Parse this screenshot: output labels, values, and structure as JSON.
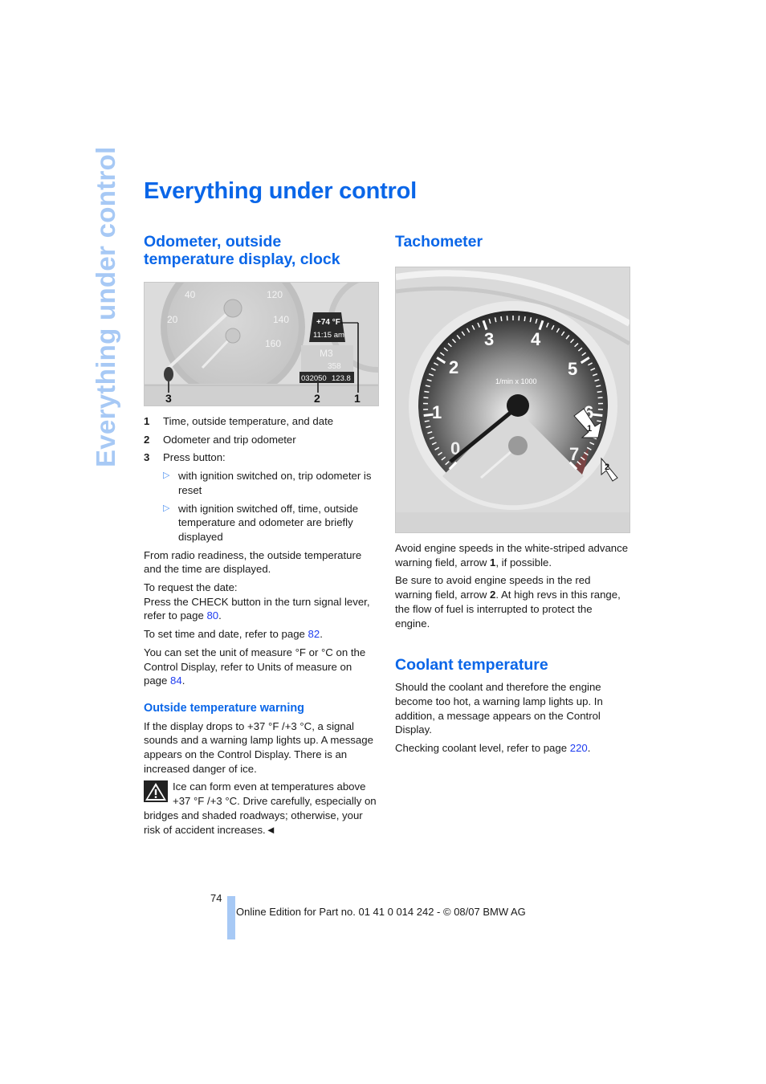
{
  "side_tab": "Everything under control",
  "page_title": "Everything under control",
  "left": {
    "heading": "Odometer, outside temperature display, clock",
    "figure": {
      "speedo_ticks": [
        "20",
        "40",
        "120",
        "140",
        "160"
      ],
      "temperature": "+74 °F",
      "time": "11:15 am",
      "model": "M3",
      "range": "358",
      "odometer": "032050",
      "trip": "123.8",
      "callouts": [
        "3",
        "2",
        "1"
      ]
    },
    "items": [
      {
        "num": "1",
        "text": "Time, outside temperature, and date"
      },
      {
        "num": "2",
        "text": "Odometer and trip odometer"
      },
      {
        "num": "3",
        "text": "Press button:"
      }
    ],
    "bullets": [
      "with ignition switched on, trip odometer is reset",
      "with ignition switched off, time, outside temperature and odometer are briefly displayed"
    ],
    "para_radio": "From radio readiness, the outside temperature and the time are displayed.",
    "para_date_1": "To request the date:",
    "para_date_2": "Press the CHECK button in the turn signal lever, refer to page ",
    "para_date_ref": "80",
    "para_set": "To set time and date, refer to page ",
    "para_set_ref": "82",
    "para_unit": "You can set the unit of measure °F or °C on the Control Display, refer to Units of measure on page ",
    "para_unit_ref": "84",
    "subheading": "Outside temperature warning",
    "para_warn": "If the display drops to +37 °F /+3 °C, a signal sounds and a warning lamp lights up. A message appears on the Control Display. There is an increased danger of ice.",
    "caution": "Ice can form even at temperatures above +37 °F /+3 °C. Drive carefully, especially on bridges and shaded roadways; otherwise, your risk of accident increases.◄"
  },
  "right": {
    "heading": "Tachometer",
    "figure": {
      "scale": [
        "0",
        "1",
        "2",
        "3",
        "4",
        "5",
        "6",
        "7"
      ],
      "unit_label": "1/min x 1000",
      "callouts": [
        "1",
        "2"
      ]
    },
    "para_1a": "Avoid engine speeds in the white-striped advance warning field, arrow ",
    "para_1b": "1",
    "para_1c": ", if possible.",
    "para_2a": "Be sure to avoid engine speeds in the red warning field, arrow ",
    "para_2b": "2",
    "para_2c": ". At high revs in this range, the flow of fuel is interrupted to protect the engine.",
    "heading2": "Coolant temperature",
    "para_3": "Should the coolant and therefore the engine become too hot, a warning lamp lights up. In addition, a message appears on the Control Display.",
    "para_4": "Checking coolant level, refer to page ",
    "para_4_ref": "220"
  },
  "footer": {
    "page_number": "74",
    "text": "Online Edition for Part no. 01 41 0 014 242 - © 08/07 BMW AG"
  }
}
